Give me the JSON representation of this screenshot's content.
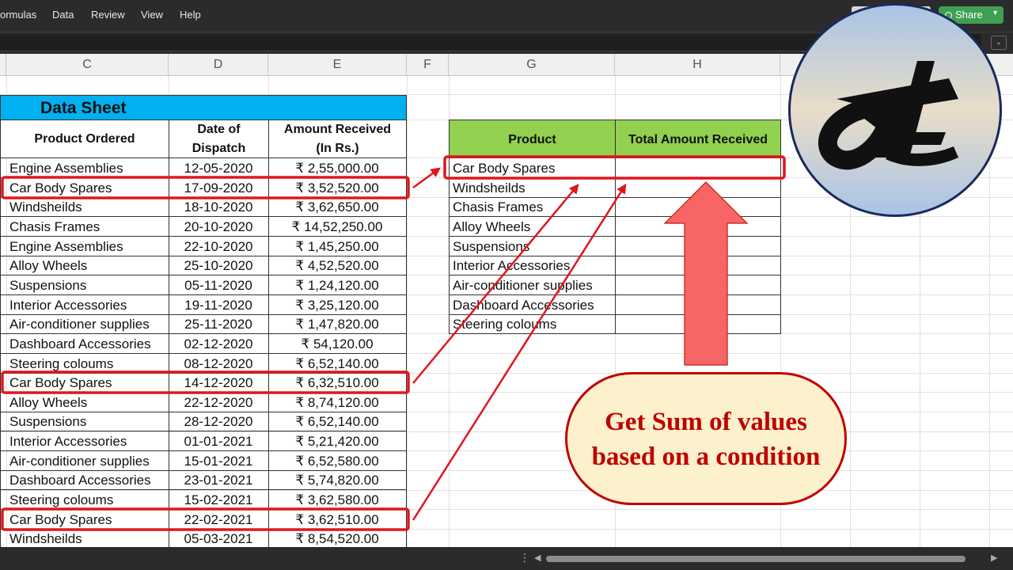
{
  "ribbon": {
    "menu_items": [
      "ormulas",
      "Data",
      "Review",
      "View",
      "Help"
    ],
    "share_label": "Share"
  },
  "columns": [
    "C",
    "D",
    "E",
    "F",
    "G",
    "H"
  ],
  "data_sheet": {
    "title": "Data Sheet",
    "headers": {
      "product": "Product Ordered",
      "date_line1": "Date of",
      "date_line2": "Dispatch",
      "amount_line1": "Amount Received",
      "amount_line2": "(In Rs.)"
    },
    "rows": [
      {
        "product": "Engine Assemblies",
        "date": "12-05-2020",
        "amount": "₹ 2,55,000.00"
      },
      {
        "product": "Car Body Spares",
        "date": "17-09-2020",
        "amount": "₹ 3,52,520.00"
      },
      {
        "product": "Windsheilds",
        "date": "18-10-2020",
        "amount": "₹ 3,62,650.00"
      },
      {
        "product": "Chasis Frames",
        "date": "20-10-2020",
        "amount": "₹ 14,52,250.00"
      },
      {
        "product": "Engine Assemblies",
        "date": "22-10-2020",
        "amount": "₹ 1,45,250.00"
      },
      {
        "product": "Alloy Wheels",
        "date": "25-10-2020",
        "amount": "₹ 4,52,520.00"
      },
      {
        "product": "Suspensions",
        "date": "05-11-2020",
        "amount": "₹ 1,24,120.00"
      },
      {
        "product": "Interior Accessories",
        "date": "19-11-2020",
        "amount": "₹ 3,25,120.00"
      },
      {
        "product": "Air-conditioner supplies",
        "date": "25-11-2020",
        "amount": "₹ 1,47,820.00"
      },
      {
        "product": "Dashboard Accessories",
        "date": "02-12-2020",
        "amount": "₹ 54,120.00"
      },
      {
        "product": "Steering coloums",
        "date": "08-12-2020",
        "amount": "₹ 6,52,140.00"
      },
      {
        "product": "Car Body Spares",
        "date": "14-12-2020",
        "amount": "₹ 6,32,510.00"
      },
      {
        "product": "Alloy Wheels",
        "date": "22-12-2020",
        "amount": "₹ 8,74,120.00"
      },
      {
        "product": "Suspensions",
        "date": "28-12-2020",
        "amount": "₹ 6,52,140.00"
      },
      {
        "product": "Interior Accessories",
        "date": "01-01-2021",
        "amount": "₹ 5,21,420.00"
      },
      {
        "product": "Air-conditioner supplies",
        "date": "15-01-2021",
        "amount": "₹ 6,52,580.00"
      },
      {
        "product": "Dashboard Accessories",
        "date": "23-01-2021",
        "amount": "₹ 5,74,820.00"
      },
      {
        "product": "Steering coloums",
        "date": "15-02-2021",
        "amount": "₹ 3,62,580.00"
      },
      {
        "product": "Car Body Spares",
        "date": "22-02-2021",
        "amount": "₹ 3,62,510.00"
      },
      {
        "product": "Windsheilds",
        "date": "05-03-2021",
        "amount": "₹ 8,54,520.00"
      }
    ],
    "highlighted_rows": [
      1,
      11,
      18
    ]
  },
  "summary": {
    "headers": {
      "product": "Product",
      "total": "Total Amount Received"
    },
    "products": [
      "Car Body Spares",
      "Windsheilds",
      "Chasis Frames",
      "Alloy Wheels",
      "Suspensions",
      "Interior Accessories",
      "Air-conditioner supplies",
      "Dashboard Accessories",
      "Steering coloums"
    ]
  },
  "callout": {
    "line1": "Get Sum of values",
    "line2": "based on a condition"
  },
  "colors": {
    "data_sheet_title_bg": "#00b0f0",
    "summary_header_bg": "#92d050",
    "highlight": "#e0161d",
    "big_arrow": "#f76565",
    "callout_bg": "#fdf0cc",
    "callout_text": "#c00000"
  }
}
